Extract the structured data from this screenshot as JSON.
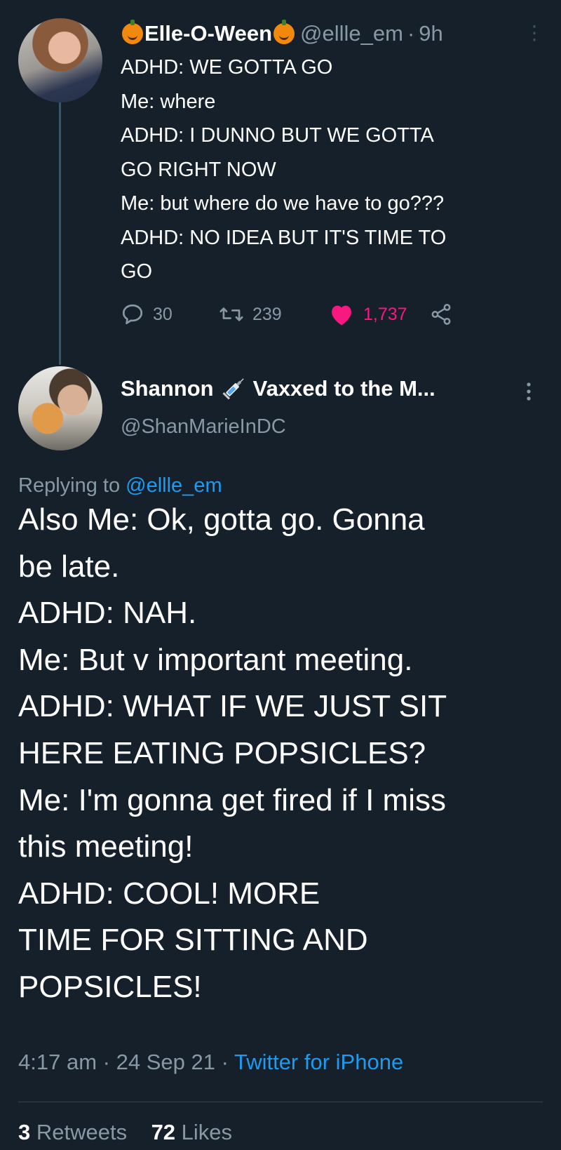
{
  "parent_tweet": {
    "display_name": "Elle-O-Ween",
    "name_emoji": "jack-o-lantern",
    "handle": "@ellle_em",
    "separator": "·",
    "time": "9h",
    "text_lines": [
      "ADHD: WE GOTTA GO",
      "Me: where",
      "ADHD: I DUNNO BUT WE GOTTA",
      "GO RIGHT NOW",
      "Me: but where do we have to go???",
      "ADHD: NO IDEA BUT IT'S TIME TO",
      "GO"
    ],
    "replies": "30",
    "retweets": "239",
    "likes": "1,737",
    "liked": true
  },
  "reply_tweet": {
    "display_name_start": "Shannon",
    "name_emoji": "syringe",
    "display_name_end": "Vaxxed to the M...",
    "handle": "@ShanMarieInDC",
    "replying_prefix": "Replying to",
    "replying_to": "@ellle_em",
    "text_lines": [
      "Also Me: Ok, gotta go. Gonna",
      "be late.",
      "ADHD: NAH.",
      "Me: But v important meeting.",
      "ADHD: WHAT IF WE JUST SIT",
      "HERE EATING POPSICLES?",
      "Me: I'm gonna get fired if I miss",
      "this meeting!",
      "ADHD: COOL! MORE",
      "TIME FOR SITTING AND",
      "POPSICLES!"
    ],
    "time": "4:17 am",
    "date": "24 Sep 21",
    "sep": "·",
    "source": "Twitter for iPhone",
    "retweets_count": "3",
    "retweets_label": "Retweets",
    "likes_count": "72",
    "likes_label": "Likes"
  },
  "colors": {
    "background": "#15202b",
    "secondary_text": "#8899a6",
    "link": "#1d9bf0",
    "like": "#f91880"
  }
}
